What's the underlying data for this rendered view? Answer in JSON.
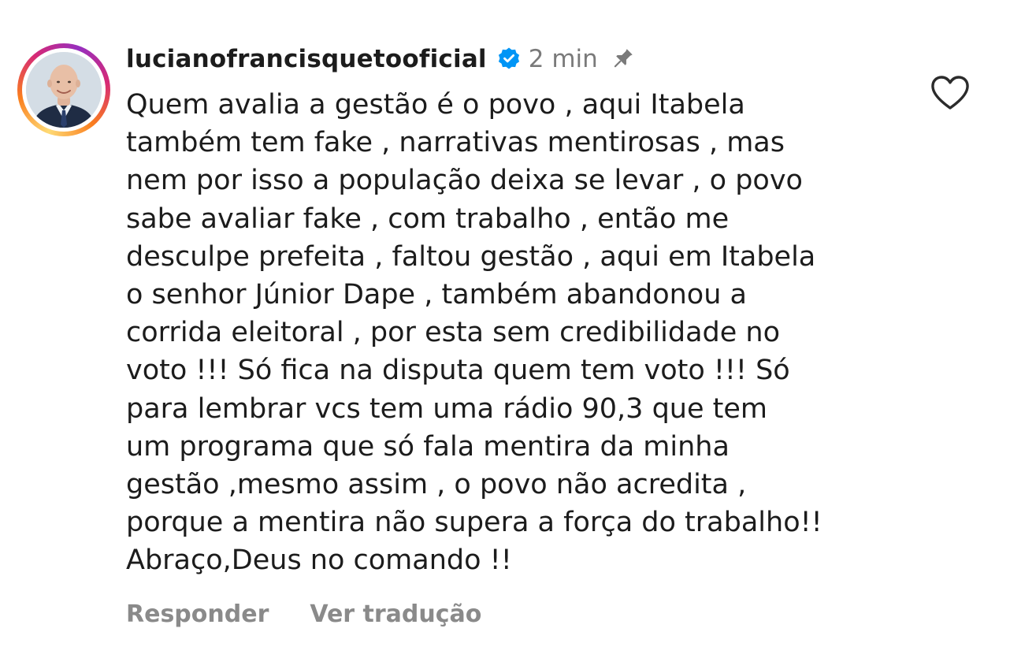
{
  "comment": {
    "username": "lucianofrancisquetooficial",
    "verified": true,
    "timestamp": "2 min",
    "pinned": true,
    "liked": false,
    "text": "Quem avalia a gestão é o povo , aqui Itabela\ntambém tem fake , narrativas mentirosas , mas\nnem por isso  a população deixa se levar , o povo\nsabe avaliar fake , com trabalho , então me\ndesculpe prefeita , faltou gestão , aqui em Itabela\no senhor  Júnior Dape , também abandonou a\ncorrida eleitoral , por esta sem credibilidade no\nvoto !!! Só fica na disputa quem tem voto !!! Só\npara lembrar vcs tem uma rádio  90,3 que tem\num programa que só fala mentira da minha\ngestão ,mesmo assim , o povo não acredita ,\nporque a mentira não supera a força do trabalho!!\nAbraço,Deus no comando !!",
    "actions": {
      "reply": "Responder",
      "translate": "Ver tradução"
    }
  },
  "icons": {
    "verified": "verified-badge-icon",
    "pin": "pin-icon",
    "like": "heart-outline-icon"
  },
  "colors": {
    "verified_blue": "#0095f6",
    "muted_text": "#8a8a8a",
    "primary_text": "#1c1c1c",
    "story_ring_start": "#feda75",
    "story_ring_end": "#962fbf"
  }
}
